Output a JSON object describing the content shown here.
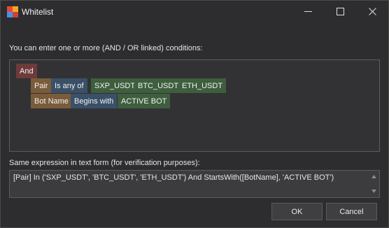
{
  "window": {
    "title": "Whitelist"
  },
  "conditions_label": "You can enter one or more (AND / OR linked) conditions:",
  "conditions": {
    "root": {
      "label": "And",
      "color": "#6e3b3b"
    },
    "rows": [
      {
        "field": {
          "label": "Pair",
          "color": "#7a5c3a"
        },
        "operator": {
          "label": "Is any of",
          "color": "#3a5068"
        },
        "values": [
          {
            "label": "SXP_USDT",
            "color": "#3e5e3e"
          },
          {
            "label": "BTC_USDT",
            "color": "#3e5e3e"
          },
          {
            "label": "ETH_USDT",
            "color": "#3e5e3e"
          }
        ]
      },
      {
        "field": {
          "label": "Bot Name",
          "color": "#7a5c3a"
        },
        "operator": {
          "label": "Begins with",
          "color": "#3a5068"
        },
        "values": [
          {
            "label": "ACTIVE BOT",
            "color": "#3e5e3e"
          }
        ]
      }
    ]
  },
  "expression_label": "Same expression in text form (for verification purposes):",
  "expression_text": "[Pair] In ('SXP_USDT', 'BTC_USDT', 'ETH_USDT') And StartsWith([BotName], 'ACTIVE BOT')",
  "buttons": {
    "ok": "OK",
    "cancel": "Cancel"
  },
  "icons": {
    "app": "app-logo-icon",
    "minimize": "minimize-icon",
    "maximize": "maximize-icon",
    "close": "close-icon",
    "scroll_up": "scroll-up-arrow-icon",
    "scroll_down": "scroll-down-arrow-icon"
  },
  "colors": {
    "background": "#2d2d30",
    "panel": "#323234",
    "logical_tag": "#6e3b3b",
    "field_tag": "#7a5c3a",
    "operator_tag": "#3a5068",
    "value_tag": "#3e5e3e"
  }
}
